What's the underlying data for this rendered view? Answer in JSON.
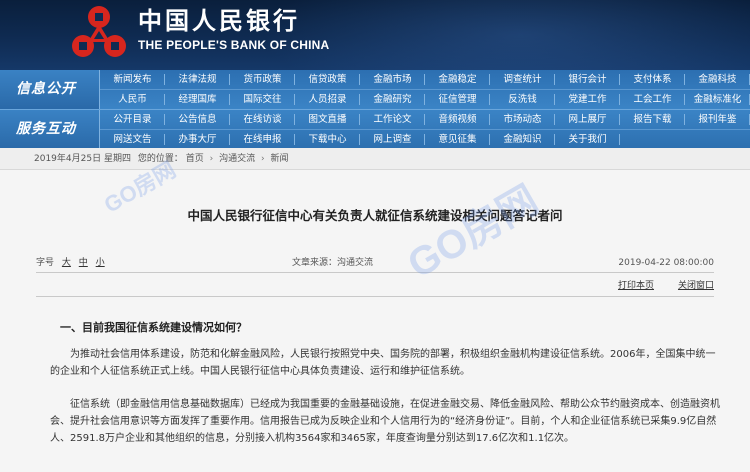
{
  "header": {
    "logo_cn": "中国人民银行",
    "logo_en": "THE PEOPLE'S BANK OF CHINA",
    "logo_icon": "pboc-emblem-icon"
  },
  "nav": {
    "groups": [
      {
        "label": "信息公开",
        "rows": [
          [
            "新闻发布",
            "法律法规",
            "货币政策",
            "信贷政策",
            "金融市场",
            "金融稳定",
            "调查统计",
            "银行会计",
            "支付体系",
            "金融科技"
          ],
          [
            "人民币",
            "经理国库",
            "国际交往",
            "人员招录",
            "金融研究",
            "征信管理",
            "反洗钱",
            "党建工作",
            "工会工作",
            "金融标准化"
          ]
        ]
      },
      {
        "label": "服务互动",
        "rows": [
          [
            "公开目录",
            "公告信息",
            "在线访谈",
            "图文直播",
            "工作论文",
            "音频视频",
            "市场动态",
            "网上展厅",
            "报告下载",
            "报刊年鉴"
          ],
          [
            "网送文告",
            "办事大厅",
            "在线申报",
            "下载中心",
            "网上调查",
            "意见征集",
            "金融知识",
            "关于我们"
          ]
        ]
      }
    ]
  },
  "breadcrumb": {
    "date": "2019年4月25日 星期四",
    "prefix": "您的位置：",
    "items": [
      "首页",
      "沟通交流",
      "新闻"
    ],
    "separator": "›"
  },
  "article": {
    "title": "中国人民银行征信中心有关负责人就征信系统建设相关问题答记者问",
    "font_size_label": "字号",
    "font_sizes": [
      "大",
      "中",
      "小"
    ],
    "source_label": "文章来源：",
    "source": "沟通交流",
    "date": "2019-04-22 08:00:00",
    "print_label": "打印本页",
    "close_label": "关闭窗口",
    "section_heading": "一、目前我国征信系统建设情况如何？",
    "paragraphs": [
      "为推动社会信用体系建设，防范和化解金融风险，人民银行按照党中央、国务院的部署，积极组织金融机构建设征信系统。2006年，全国集中统一的企业和个人征信系统正式上线。中国人民银行征信中心具体负责建设、运行和维护征信系统。",
      "征信系统（即金融信用信息基础数据库）已经成为我国重要的金融基础设施，在促进金融交易、降低金融风险、帮助公众节约融资成本、创造融资机会、提升社会信用意识等方面发挥了重要作用。信用报告已成为反映企业和个人信用行为的“经济身份证”。目前，个人和企业征信系统已采集9.9亿自然人、2591.8万户企业和其他组织的信息，分别接入机构3564家和3465家，年度查询量分别达到17.6亿次和1.1亿次。"
    ]
  },
  "watermark": {
    "text1": "GO房网",
    "text2": "GO房网"
  },
  "colors": {
    "header_bg": "#0f2b52",
    "nav_bg": "#3b84c6",
    "logo_red": "#d7261e",
    "breadcrumb_bg": "#eeeeee",
    "article_bg": "#f5f5f5"
  }
}
